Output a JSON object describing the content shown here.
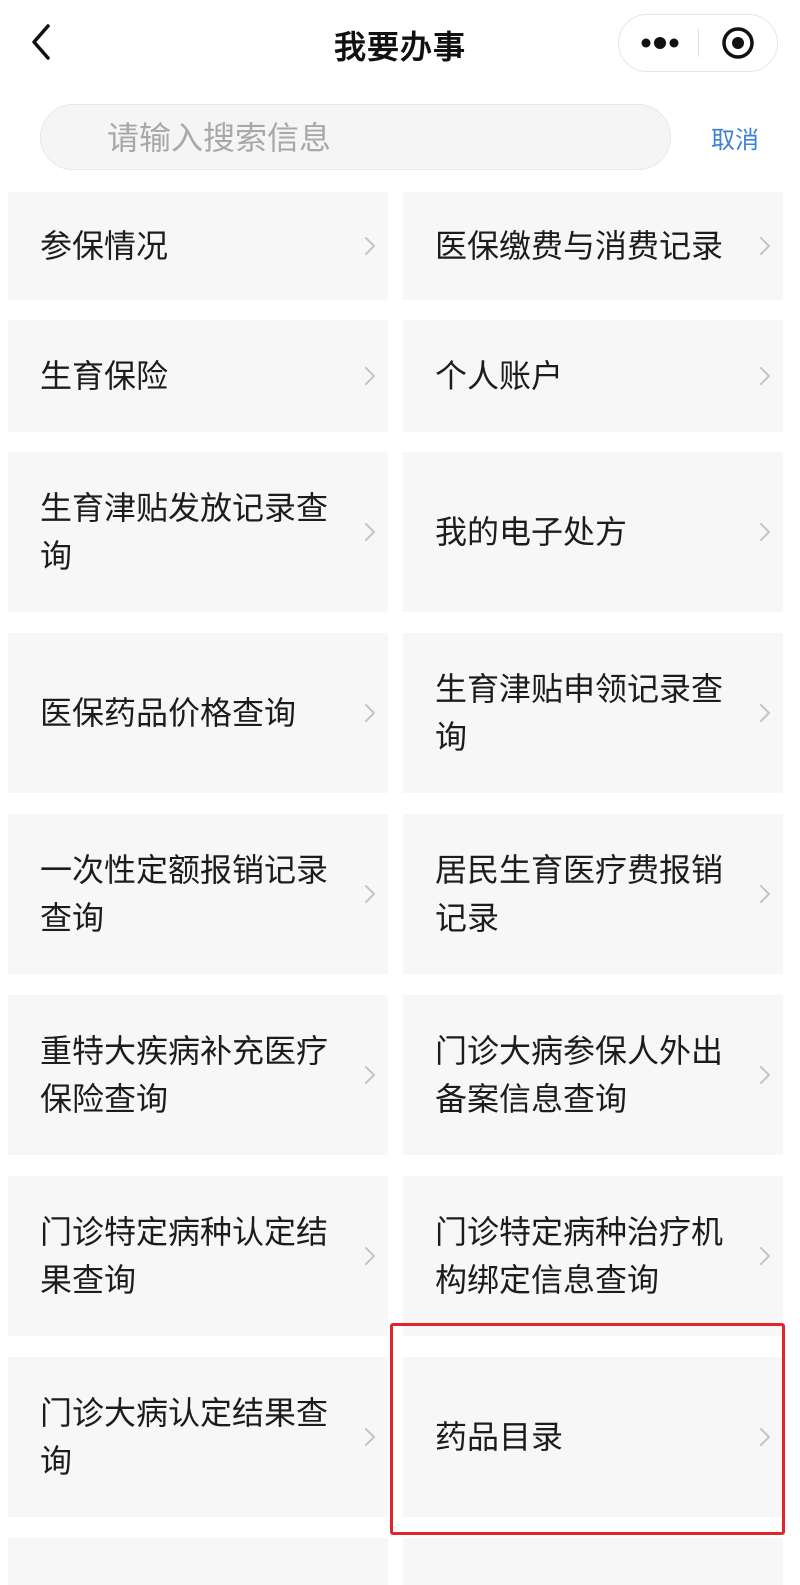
{
  "header": {
    "title": "我要办事",
    "back_icon": "back-arrow-icon",
    "more_icon": "more-dots-icon",
    "close_icon": "target-close-icon"
  },
  "search": {
    "placeholder": "请输入搜索信息",
    "value": "",
    "cancel_label": "取消"
  },
  "colors": {
    "accent": "#3d80d8",
    "card_bg": "#f7f7f7",
    "highlight": "#e0262b"
  },
  "services": [
    {
      "label": "参保情况"
    },
    {
      "label": "医保缴费与消费记录"
    },
    {
      "label": "生育保险"
    },
    {
      "label": "个人账户"
    },
    {
      "label": "生育津贴发放记录查询"
    },
    {
      "label": "我的电子处方"
    },
    {
      "label": "医保药品价格查询"
    },
    {
      "label": "生育津贴申领记录查询"
    },
    {
      "label": "一次性定额报销记录查询"
    },
    {
      "label": "居民生育医疗费报销记录"
    },
    {
      "label": "重特大疾病补充医疗保险查询"
    },
    {
      "label": "门诊大病参保人外出备案信息查询"
    },
    {
      "label": "门诊特定病种认定结果查询"
    },
    {
      "label": "门诊特定病种治疗机构绑定信息查询"
    },
    {
      "label": "门诊大病认定结果查询"
    },
    {
      "label": "药品目录",
      "highlighted": true
    }
  ],
  "chevron_icon": "chevron-right-icon"
}
